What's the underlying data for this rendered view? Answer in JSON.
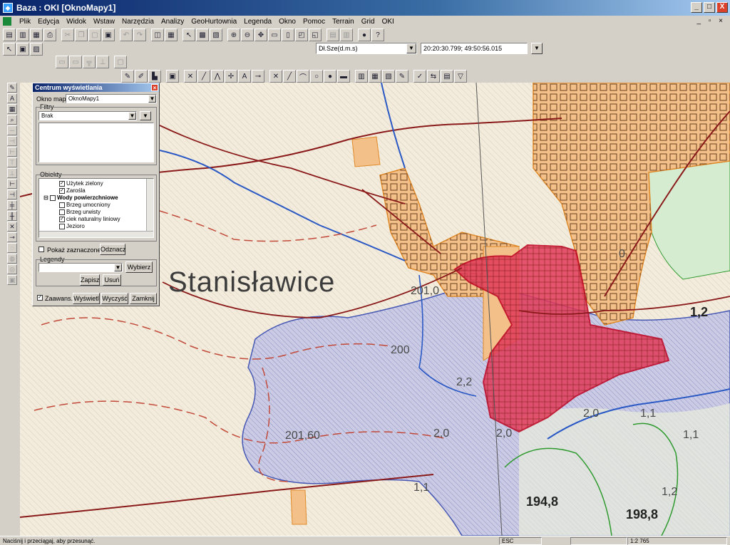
{
  "window": {
    "title": "Baza : OKI  [OknoMapy1]",
    "controls": [
      "_",
      "□",
      "X"
    ]
  },
  "menu": [
    "Plik",
    "Edycja",
    "Widok",
    "Wstaw",
    "Narzędzia",
    "Analizy",
    "GeoHurtownia",
    "Legenda",
    "Okno",
    "Pomoc",
    "Terrain",
    "Grid",
    "OKI"
  ],
  "mdi_controls": "_ ▫ ×",
  "coords": {
    "system": "Dł.Sze(d.m.s)",
    "value": "20:20:30.799; 49:50:56.015"
  },
  "map": {
    "place_name": "Stanisławice",
    "elevations": [
      {
        "id": "e201_0",
        "text": "201,0"
      },
      {
        "id": "e200",
        "text": "200"
      },
      {
        "id": "e2_2",
        "text": "2,2"
      },
      {
        "id": "e201_60",
        "text": "201,60"
      },
      {
        "id": "e2_0a",
        "text": "2,0"
      },
      {
        "id": "e2_0b",
        "text": "2,0"
      },
      {
        "id": "e2_0c",
        "text": "2,0"
      },
      {
        "id": "e1_1a",
        "text": "1,1"
      },
      {
        "id": "e1_1b",
        "text": "1,1"
      },
      {
        "id": "e1_1c",
        "text": "1,1"
      },
      {
        "id": "e1_2a",
        "text": "1,2"
      },
      {
        "id": "e1_2b",
        "text": "1,2"
      },
      {
        "id": "e194_8",
        "text": "194,8"
      },
      {
        "id": "e198_8",
        "text": "198,8"
      },
      {
        "id": "e0",
        "text": "0"
      }
    ]
  },
  "panel": {
    "title": "Centrum wyświetlania",
    "map_window_label": "Okno mapy:",
    "map_window_value": "OknoMapy1",
    "filters_label": "Filtry",
    "filter_value": "Brak",
    "objects_label": "Obiekty",
    "tree": [
      {
        "label": "Użytek zielony",
        "checked": true,
        "indent": 2
      },
      {
        "label": "Zarośla",
        "checked": true,
        "indent": 2
      },
      {
        "label": "Wody powierzchniowe",
        "checked": false,
        "indent": 1,
        "bold": true
      },
      {
        "label": "Brzeg umocniony",
        "checked": false,
        "indent": 2
      },
      {
        "label": "Brzeg urwisty",
        "checked": false,
        "indent": 2
      },
      {
        "label": "ciek naturalny liniowy",
        "checked": true,
        "indent": 2
      },
      {
        "label": "Jezioro",
        "checked": false,
        "indent": 2
      }
    ],
    "show_selected": "Pokaż zaznaczone",
    "unselect_btn": "Odznacz",
    "legends_label": "Legendy",
    "choose_btn": "Wybierz",
    "save_btn": "Zapisz",
    "delete_btn": "Usuń",
    "advanced": "Zaawans.",
    "display_btn": "Wyświetl",
    "clear_btn": "Wyczyść",
    "close_btn": "Zamknij"
  },
  "status": {
    "hint": "Naciśnij i przeciągaj, aby przesunąć.",
    "key": "ESC",
    "scale": "1:2 765"
  },
  "colors": {
    "built_orange": "#f3c089",
    "built_red": "#e23a5a",
    "water_blue": "#b7bfe3",
    "road": "#8a1a1a",
    "forest_green": "#cfe8c8"
  }
}
